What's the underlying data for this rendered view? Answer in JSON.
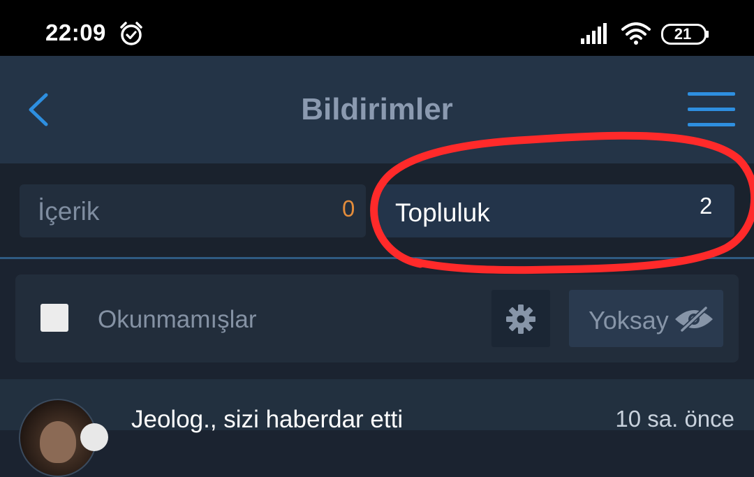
{
  "status_bar": {
    "time": "22:09",
    "battery_level": "21",
    "icons": [
      "alarm-icon",
      "signal-icon",
      "wifi-icon",
      "battery-icon"
    ]
  },
  "header": {
    "title": "Bildirimler",
    "back_icon": "chevron-left-icon",
    "menu_icon": "hamburger-menu-icon",
    "accent_color": "#2e8fe0"
  },
  "tabs": [
    {
      "label": "İçerik",
      "count": "0",
      "count_color": "#e38c3b"
    },
    {
      "label": "Topluluk",
      "count": "2",
      "selected": true
    }
  ],
  "filter_bar": {
    "checkbox_checked": false,
    "unread_label": "Okunmamışlar",
    "settings_icon": "gear-icon",
    "ignore_label": "Yoksay",
    "ignore_icon": "eye-off-icon"
  },
  "notifications": [
    {
      "text": "Jeolog., sizi haberdar etti",
      "time": "10 sa. önce"
    }
  ],
  "annotation": {
    "color": "#ff2a2a",
    "target": "tab-community"
  }
}
